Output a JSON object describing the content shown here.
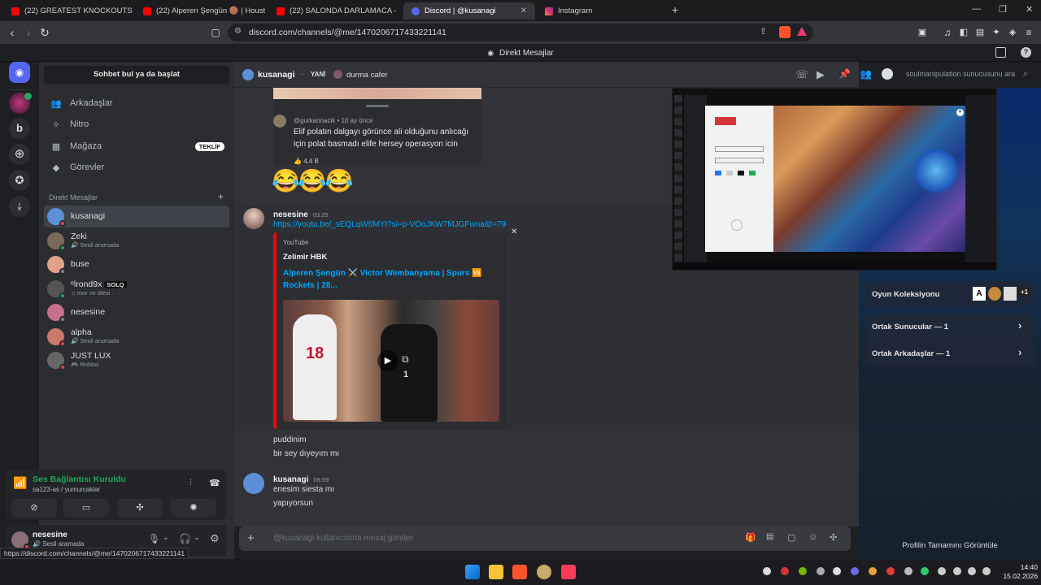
{
  "browser": {
    "tabs": [
      {
        "label": "(22) GREATEST KNOCKOUTS From 20",
        "icon": "youtube-icon"
      },
      {
        "label": "(22) Alperen Şengün 🟤 | Houston R",
        "icon": "youtube-icon"
      },
      {
        "label": "(22) SALONDA DARLAMACA - YouTu",
        "icon": "youtube-icon"
      },
      {
        "label": "Discord | @kusanagi",
        "icon": "discord-icon"
      },
      {
        "label": "Instagram",
        "icon": "instagram-icon"
      }
    ],
    "new_tab": "+",
    "url": "discord.com/channels/@me/1470206717433221141",
    "status_url": "https://discord.com/channels/@me/1470206717433221141"
  },
  "discord": {
    "title": "Direkt Mesajlar",
    "sidebar": {
      "find_button": "Sohbet bul ya da başlat",
      "nav": [
        {
          "label": "Arkadaşlar",
          "icon": "friends-icon"
        },
        {
          "label": "Nitro",
          "icon": "nitro-icon"
        },
        {
          "label": "Mağaza",
          "icon": "shop-icon",
          "badge": "TEKLİF"
        },
        {
          "label": "Görevler",
          "icon": "quests-icon"
        }
      ],
      "dm_header": "Direkt Mesajlar",
      "dm_add": "+",
      "dms": [
        {
          "name": "kusanagi",
          "sub": "",
          "color": "#5b8fd6"
        },
        {
          "name": "Zeki",
          "sub": "Sesli aramada",
          "color": "#7a6a5a"
        },
        {
          "name": "buse",
          "sub": "",
          "color": "#e0a08a"
        },
        {
          "name": "ᵉlrond9x",
          "tag": "SOLQ",
          "sub": "mor ve ötesi ·",
          "color": "#555"
        },
        {
          "name": "nesesine",
          "sub": "",
          "color": "#c86f8a"
        },
        {
          "name": "alpha",
          "sub": "Sesli aramada",
          "color": "#c97a6a"
        },
        {
          "name": "JUST LUX",
          "sub": "Roblox",
          "color": "#666"
        }
      ],
      "voice": {
        "status": "Ses Bağlantısı Kuruldu",
        "channel": "sa123-as / yumurcaklar"
      },
      "user": {
        "name": "nesesine",
        "status": "Sesli aramada"
      }
    },
    "header": {
      "username": "kusanagi",
      "tag": "YANİ",
      "activity": "durma cafer",
      "search_placeholder": "soulmanipulation sunucusunu ara"
    },
    "messages": {
      "embed_comment": {
        "user": "@gurkannacik • 10 ay önce",
        "text_1": "Elif polatın dalgayı görünce ali olduğunu anlıcağı",
        "text_2": "için polat basmadı elife hersey operasyon icin",
        "likes": "4,4 B"
      },
      "emoji_line": "😂😂😂",
      "nesesine_block": {
        "name": "nesesine",
        "time": "03:25",
        "link": "https://youtu.be/_sEQLqW6MYI?si=p-VOoJKW7MJGFwna&t=79",
        "embed_provider": "YouTube",
        "embed_author": "Zelimir HBK",
        "embed_title_1": "Alperen Şengün ⚔️ Victor Wembanyama | Spurs 🆚",
        "embed_title_2": "Rockets | 28...",
        "line_1": "puddinim",
        "line_2": "bir sey dıyeyım mı"
      },
      "kusanagi_block": {
        "name": "kusanagi",
        "time": "08:59",
        "line_1": "enesim siesta mı",
        "line_2": "yapıyorsun"
      }
    },
    "composer_placeholder": "@kusanagi kullanıcısına mesaj gönder",
    "profile_panel": {
      "game_collection": "Oyun Koleksiyonu",
      "game_count": "+1",
      "mutual_servers": "Ortak Sunucular — 1",
      "mutual_friends": "Ortak Arkadaşlar — 1",
      "view_full": "Profilin Tamamını Görüntüle"
    }
  },
  "taskbar": {
    "time": "14:40",
    "date": "15.02.2026"
  },
  "colors": {
    "accent": "#5865f2",
    "link": "#00a8fc",
    "green": "#23a55a",
    "red": "#f23f43",
    "youtube": "#ff0000"
  }
}
